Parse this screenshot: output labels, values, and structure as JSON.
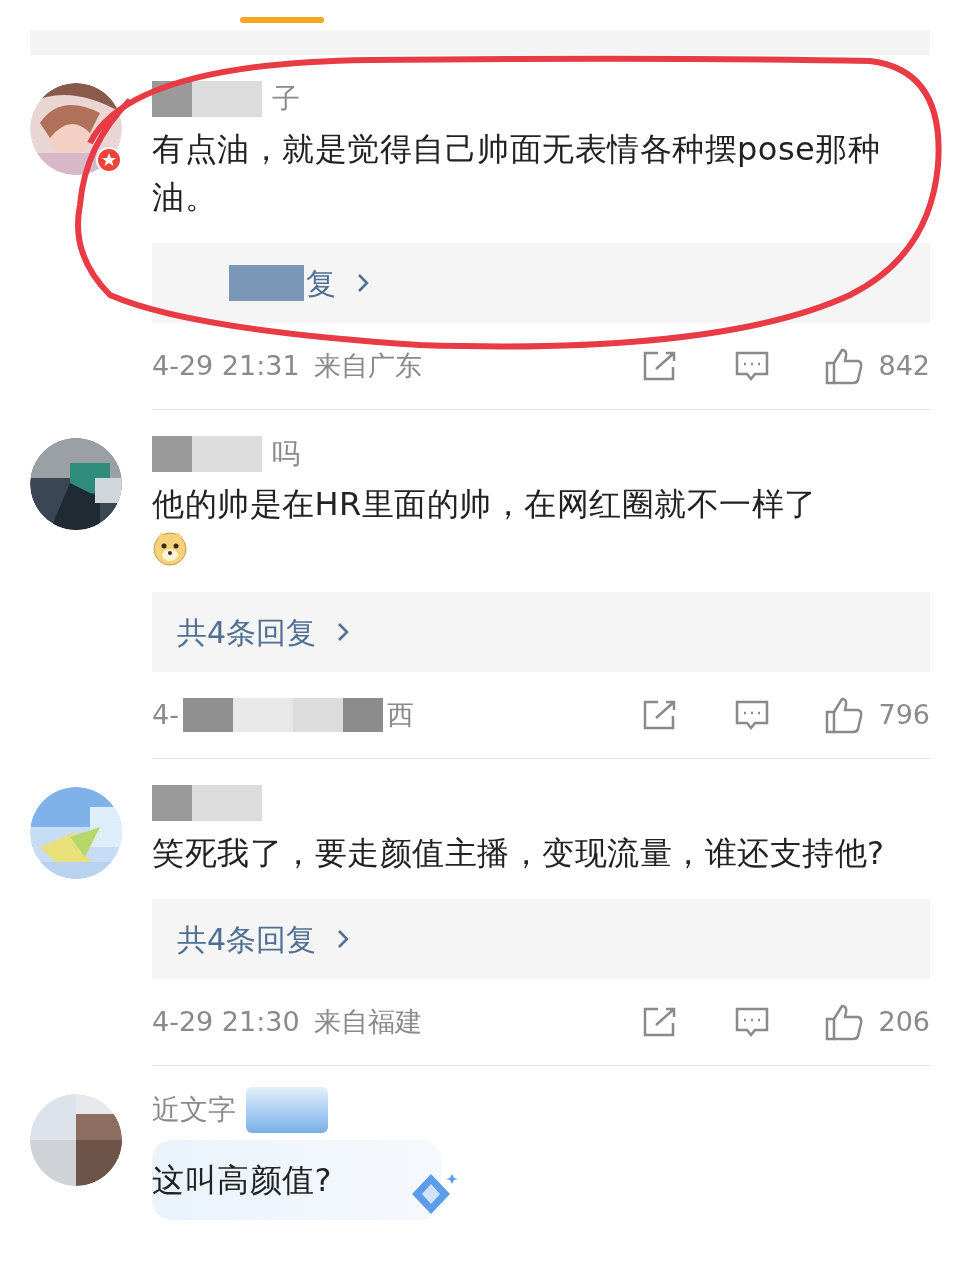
{
  "comments": [
    {
      "name_fragment": "子",
      "vip_badge": true,
      "name_badge": false,
      "annotated": true,
      "text": "有点油，就是觉得自己帅面无表情各种摆pose那种油。",
      "emoji": false,
      "bubble": false,
      "replies": {
        "text": "复",
        "redacted": true
      },
      "time": "4-29 21:31",
      "location": "来自广东",
      "time_redacted": false,
      "likes": "842"
    },
    {
      "name_fragment": "吗",
      "vip_badge": false,
      "name_badge": false,
      "annotated": false,
      "text": "他的帅是在HR里面的帅，在网红圈就不一样了",
      "emoji": true,
      "bubble": false,
      "replies": {
        "text": "共4条回复",
        "redacted": false
      },
      "time": "4-",
      "location": "西",
      "time_redacted": true,
      "likes": "796"
    },
    {
      "vip_badge": false,
      "name_badge": false,
      "annotated": false,
      "text": "笑死我了，要走颜值主播，变现流量，谁还支持他?",
      "emoji": false,
      "bubble": false,
      "replies": {
        "text": "共4条回复",
        "redacted": false
      },
      "time": "4-29 21:30",
      "location": "来自福建",
      "time_redacted": false,
      "likes": "206"
    },
    {
      "name_fragment": "近文字",
      "vip_badge": false,
      "name_badge": true,
      "annotated": false,
      "text": "这叫高颜值?",
      "emoji": false,
      "bubble": true
    }
  ]
}
